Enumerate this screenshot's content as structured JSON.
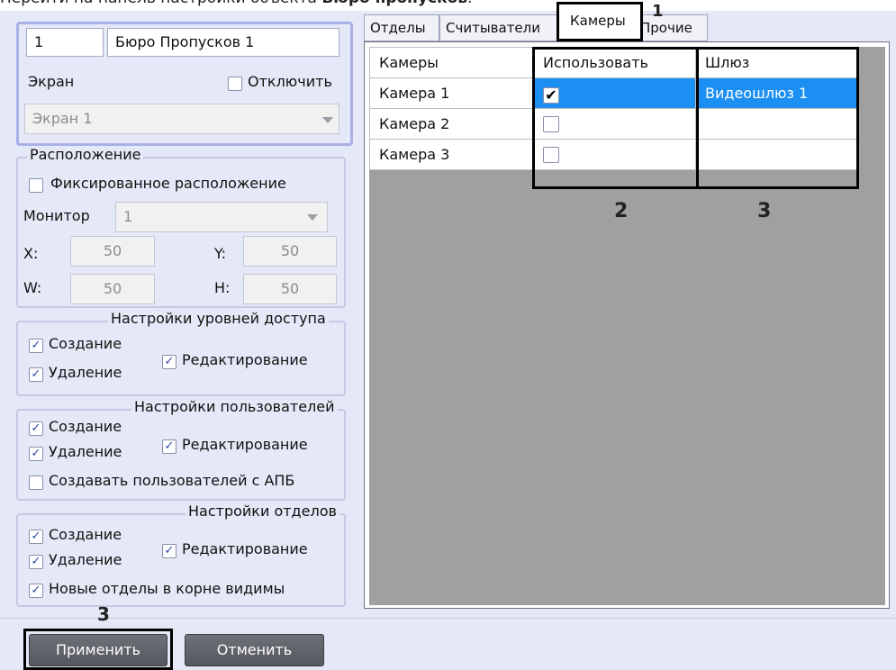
{
  "caption": {
    "prefix": "Перейти на панель настройки объекта ",
    "bold": "Бюро пропусков",
    "suffix": "."
  },
  "object": {
    "id": "1",
    "name": "Бюро Пропусков 1"
  },
  "screen": {
    "label": "Экран",
    "disable_label": "Отключить",
    "value": "Экран 1"
  },
  "location": {
    "title": "Расположение",
    "fixed_label": "Фиксированное расположение",
    "monitor_label": "Монитор",
    "monitor_value": "1",
    "x_label": "X:",
    "x_value": "50",
    "y_label": "Y:",
    "y_value": "50",
    "w_label": "W:",
    "w_value": "50",
    "h_label": "H:",
    "h_value": "50"
  },
  "access_levels": {
    "title": "Настройки уровней доступа",
    "create": "Создание",
    "delete": "Удаление",
    "edit": "Редактирование"
  },
  "users": {
    "title": "Настройки пользователей",
    "create": "Создание",
    "delete": "Удаление",
    "edit": "Редактирование",
    "apb": "Создавать пользователей с АПБ"
  },
  "departments": {
    "title": "Настройки отделов",
    "create": "Создание",
    "delete": "Удаление",
    "edit": "Редактирование",
    "root": "Новые отделы в корне видимы"
  },
  "tabs": [
    "Отделы",
    "Считыватели",
    "Камеры",
    "Прочие"
  ],
  "grid": {
    "headers": [
      "Камеры",
      "Использовать",
      "Шлюз"
    ],
    "rows": [
      {
        "camera": "Камера 1",
        "use": true,
        "gateway": "Видеошлюз 1"
      },
      {
        "camera": "Камера 2",
        "use": false,
        "gateway": ""
      },
      {
        "camera": "Камера 3",
        "use": false,
        "gateway": ""
      }
    ]
  },
  "annotations": {
    "n1": "1",
    "n2": "2",
    "n3": "3",
    "n3b": "3"
  },
  "buttons": {
    "apply": "Применить",
    "cancel": "Отменить"
  },
  "colors": {
    "panel": "#e5e8f6",
    "group_border": "#aab0e6",
    "selection": "#1c8ff3"
  }
}
